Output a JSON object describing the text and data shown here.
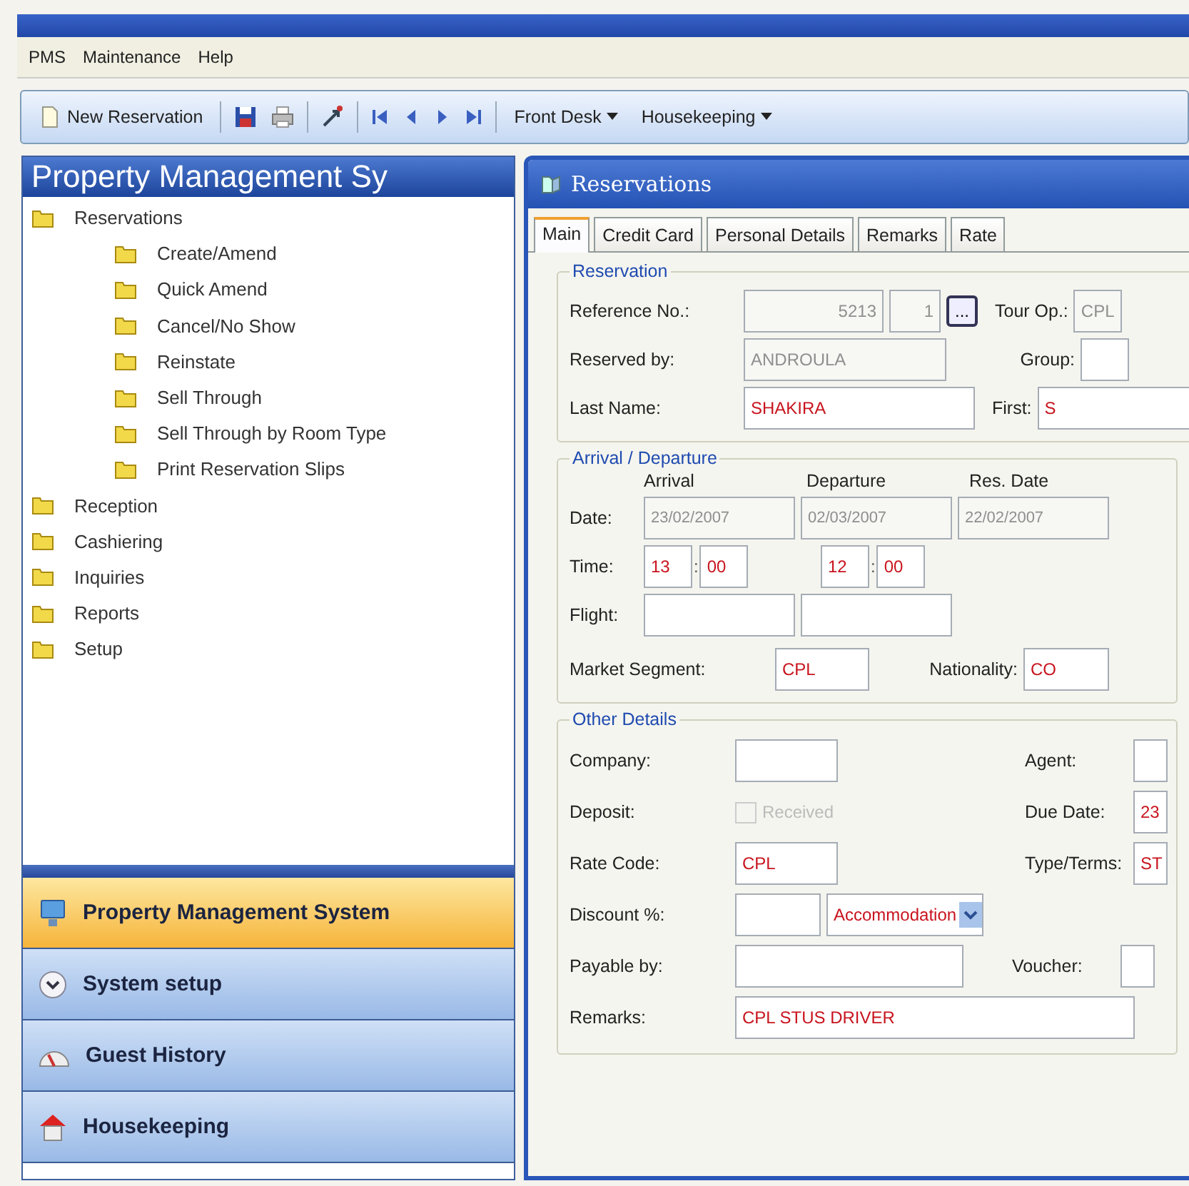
{
  "menu": [
    "PMS",
    "Maintenance",
    "Help"
  ],
  "toolbar": {
    "new_reservation": "New Reservation",
    "dropdowns": [
      "Front Desk",
      "Housekeeping"
    ]
  },
  "sidebar": {
    "title": "Property Management Sy",
    "tree": [
      {
        "label": "Reservations",
        "children": [
          {
            "label": "Create/Amend"
          },
          {
            "label": "Quick Amend"
          },
          {
            "label": "Cancel/No Show"
          },
          {
            "label": "Reinstate"
          },
          {
            "label": "Sell Through"
          },
          {
            "label": "Sell Through by Room Type"
          },
          {
            "label": "Print Reservation Slips"
          }
        ]
      },
      {
        "label": "Reception"
      },
      {
        "label": "Cashiering"
      },
      {
        "label": "Inquiries"
      },
      {
        "label": "Reports"
      },
      {
        "label": "Setup"
      }
    ],
    "nav": [
      {
        "label": "Property Management System",
        "kind": "monitor",
        "selected": true
      },
      {
        "label": "System setup",
        "kind": "chevron",
        "selected": false
      },
      {
        "label": "Guest History",
        "kind": "gauge",
        "selected": false
      },
      {
        "label": "Housekeeping",
        "kind": "house",
        "selected": false
      }
    ]
  },
  "reservations": {
    "title": "Reservations",
    "tabs": [
      {
        "label": "Main",
        "selected": true
      },
      {
        "label": "Credit Card",
        "selected": false
      },
      {
        "label": "Personal Details",
        "selected": false
      },
      {
        "label": "Remarks",
        "selected": false
      },
      {
        "label": "Rate",
        "selected": false
      }
    ],
    "reservation": {
      "legend": "Reservation",
      "reference": {
        "label": "Reference No.:",
        "value": "5213",
        "sub_value": "1",
        "disabled": true,
        "lookup": "..."
      },
      "tour_op": {
        "label": "Tour Op.:",
        "value": "CPL",
        "disabled": true
      },
      "reserved_by": {
        "label": "Reserved by:",
        "value": "ANDROULA",
        "disabled": true
      },
      "group": {
        "label": "Group:"
      },
      "last_name": {
        "label": "Last Name:",
        "value": "SHAKIRA",
        "disabled": false
      },
      "first": {
        "label": "First:",
        "value": "S",
        "disabled": false
      }
    },
    "arrival_departure": {
      "legend": "Arrival / Departure",
      "columns": [
        "Arrival",
        "Departure",
        "Res. Date"
      ],
      "date_label": "Date:",
      "dates": [
        {
          "value": "23/02/2007",
          "disabled": true
        },
        {
          "value": "02/03/2007",
          "disabled": true
        },
        {
          "value": "22/02/2007",
          "disabled": true
        }
      ],
      "time_label": "Time:",
      "time_separator": ":",
      "times": [
        {
          "hour": "13",
          "minute": "00"
        },
        {
          "hour": "12",
          "minute": "00"
        }
      ],
      "flight_label": "Flight:",
      "market_segment": {
        "label": "Market Segment:",
        "value": "CPL"
      },
      "nationality": {
        "label": "Nationality:",
        "value": "CO"
      }
    },
    "other_details": {
      "legend": "Other Details",
      "company": {
        "label": "Company:"
      },
      "agent": {
        "label": "Agent:"
      },
      "deposit": {
        "label": "Deposit:",
        "checkbox_label": "Received",
        "checked": false,
        "disabled": true
      },
      "due_date": {
        "label": "Due Date:",
        "value": "23"
      },
      "rate_code": {
        "label": "Rate Code:",
        "value": "CPL"
      },
      "type_terms": {
        "label": "Type/Terms:",
        "value": "ST"
      },
      "discount": {
        "label": "Discount %:",
        "dropdown": "Accommodation"
      },
      "payable_by": {
        "label": "Payable by:"
      },
      "voucher": {
        "label": "Voucher:"
      },
      "remarks": {
        "label": "Remarks:",
        "value": "CPL STUS DRIVER"
      }
    }
  }
}
